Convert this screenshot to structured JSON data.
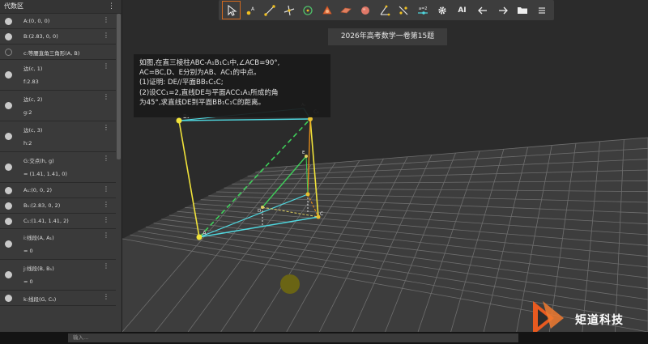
{
  "sidebar": {
    "title": "代数区",
    "menu_icon": "⋮",
    "items": [
      {
        "text": "A:(0, 0, 0)",
        "marker": "dot"
      },
      {
        "text": "B:(2.83, 0, 0)",
        "marker": "dot"
      },
      {
        "text": "c:等腰直角三角形(A, B)",
        "marker": "ring"
      },
      {
        "text": "边(c, 1)",
        "sub": "f:2.83",
        "marker": "dot"
      },
      {
        "text": "边(c, 2)",
        "sub": "g:2",
        "marker": "dot"
      },
      {
        "text": "边(c, 3)",
        "sub": "h:2",
        "marker": "dot"
      },
      {
        "text": "G:交点(h, g)",
        "sub": "= (1.41, 1.41, 0)",
        "marker": "dot"
      },
      {
        "text": "A₁:(0, 0, 2)",
        "marker": "dot"
      },
      {
        "text": "B₁:(2.83, 0, 2)",
        "marker": "dot"
      },
      {
        "text": "C₁:(1.41, 1.41, 2)",
        "marker": "dot"
      },
      {
        "text": "i:线段(A, A₁)",
        "sub": "= 0",
        "marker": "dot"
      },
      {
        "text": "j:线段(B, B₁)",
        "sub": "= 0",
        "marker": "dot"
      },
      {
        "text": "k:线段(G, C₁)",
        "marker": "dot"
      }
    ]
  },
  "toolbar": {
    "tools": [
      {
        "name": "select-tool-icon",
        "active": true
      },
      {
        "name": "point-tool-icon"
      },
      {
        "name": "segment-tool-icon"
      },
      {
        "name": "perpendicular-line-tool-icon"
      },
      {
        "name": "circle-tool-icon"
      },
      {
        "name": "angle-tool-icon"
      },
      {
        "name": "plane-tool-icon"
      },
      {
        "name": "sphere-tool-icon"
      },
      {
        "name": "measure-angle-tool-icon"
      },
      {
        "name": "reflect-tool-icon"
      },
      {
        "name": "slider-tool-icon"
      },
      {
        "name": "settings-gear-icon"
      },
      {
        "name": "ai-button",
        "label": "AI"
      },
      {
        "name": "undo-arrow-icon"
      },
      {
        "name": "redo-arrow-icon"
      },
      {
        "name": "folder-icon"
      },
      {
        "name": "main-menu-icon"
      }
    ]
  },
  "graphics": {
    "title": "2026年高考数学一卷第15题",
    "problem_lines": [
      "如图,在直三棱柱ABC-A₁B₁C₁中,∠ACB=90°,",
      "AC=BC,D、E分别为AB、AC₁的中点。",
      "(1)证明: DE//平面BB₁C₁C;",
      "(2)设CC₁=2,直线DE与平面ACC₁A₁所成的角",
      "为45°,求直线DE到平面BB₁C₁C的距离。"
    ],
    "point_labels": {
      "A": "A",
      "B1": "B₁",
      "C1": "C₁",
      "C": "C",
      "D": "D",
      "E": "E",
      "A1": "A₁"
    }
  },
  "input_bar": {
    "placeholder": "输入..."
  },
  "brand": {
    "name": "矩道科技"
  },
  "colors": {
    "accent": "#d2691e",
    "edge_yellow": "#f0e23a",
    "edge_cyan": "#4fd8e0",
    "edge_green": "#3fcf5a",
    "edge_orange": "#e08a1a",
    "grid": "#7a7a7a"
  }
}
